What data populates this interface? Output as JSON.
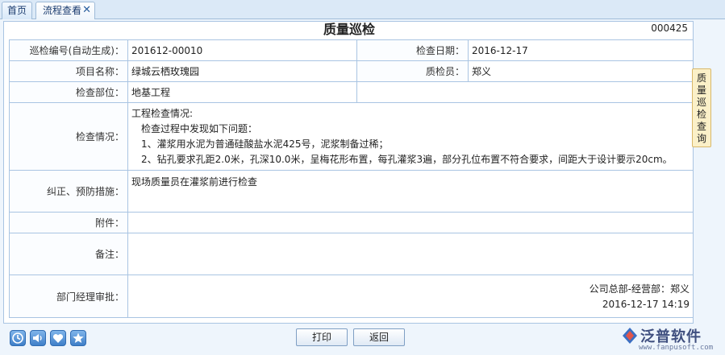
{
  "tabs": [
    {
      "label": "首页"
    },
    {
      "label": "流程查看",
      "close": "✕"
    }
  ],
  "form": {
    "title": "质量巡检",
    "doc_no": "000425",
    "fields": {
      "inspection_no_label": "巡检编号(自动生成)：",
      "inspection_no": "201612-00010",
      "check_date_label": "检查日期：",
      "check_date": "2016-12-17",
      "project_label": "项目名称：",
      "project": "绿城云栖玫瑰园",
      "inspector_label": "质检员：",
      "inspector": "郑义",
      "part_label": "检查部位：",
      "part": "地基工程",
      "situation_label": "检查情况：",
      "situation_lines": [
        "工程检查情况:",
        "　检查过程中发现如下问题：",
        "　1、灌浆用水泥为普通硅酸盐水泥425号，泥浆制备过稀；",
        "　2、钻孔要求孔距2.0米，孔深10.0米，呈梅花形布置，每孔灌浆3遍，部分孔位布置不符合要求，间距大于设计要示20cm。"
      ],
      "measures_label": "纠正、预防措施：",
      "measures": "现场质量员在灌浆前进行检查",
      "attachment_label": "附件：",
      "attachment": "",
      "remark_label": "备注：",
      "remark": "",
      "approval_label": "部门经理审批：",
      "approval_dept": "公司总部-经营部：郑义",
      "approval_time": "2016-12-17 14:19"
    }
  },
  "side_tab": {
    "chars": [
      "质",
      "量",
      "巡",
      "检",
      "查",
      "询"
    ]
  },
  "toolbar": {
    "icons": [
      "clock-icon",
      "speaker-icon",
      "heart-icon",
      "star-icon"
    ],
    "print_label": "打印",
    "back_label": "返回"
  },
  "brand": {
    "name": "泛普软件",
    "url": "www.fanpusoft.com"
  }
}
